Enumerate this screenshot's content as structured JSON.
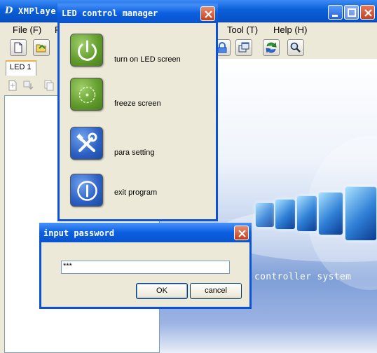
{
  "main_window": {
    "title": "XMPlaye",
    "logo": "D",
    "caption_buttons": [
      "minimize-icon",
      "maximize-icon",
      "close-icon"
    ]
  },
  "menu": {
    "file": "File (F)",
    "partial": "F",
    "tool": "Tool (T)",
    "help": "Help (H)"
  },
  "toolbar": {
    "buttons": [
      "new-document-icon",
      "open-folder-icon",
      "lock-icon",
      "windows-icon",
      "refresh-icon",
      "search-icon"
    ]
  },
  "tabs": [
    {
      "label": "LED 1",
      "selected": true
    }
  ],
  "splash": {
    "text": "controller system"
  },
  "led_dialog": {
    "title": "LED control manager",
    "items": [
      {
        "label": "turn on LED screen",
        "icon": "power-icon",
        "color": "green"
      },
      {
        "label": "freeze screen",
        "icon": "freeze-icon",
        "color": "green"
      },
      {
        "label": "para setting",
        "icon": "tools-icon",
        "color": "blue"
      },
      {
        "label": "exit program",
        "icon": "exit-icon",
        "color": "blue"
      }
    ]
  },
  "password_dialog": {
    "title": "input password",
    "value": "***",
    "ok_label": "OK",
    "cancel_label": "cancel"
  },
  "colors": {
    "titlebar": "#0a5fd8",
    "dialog_bg": "#ece9d8",
    "close_red": "#c6401e",
    "splash_blue": "#7f9fd8"
  }
}
